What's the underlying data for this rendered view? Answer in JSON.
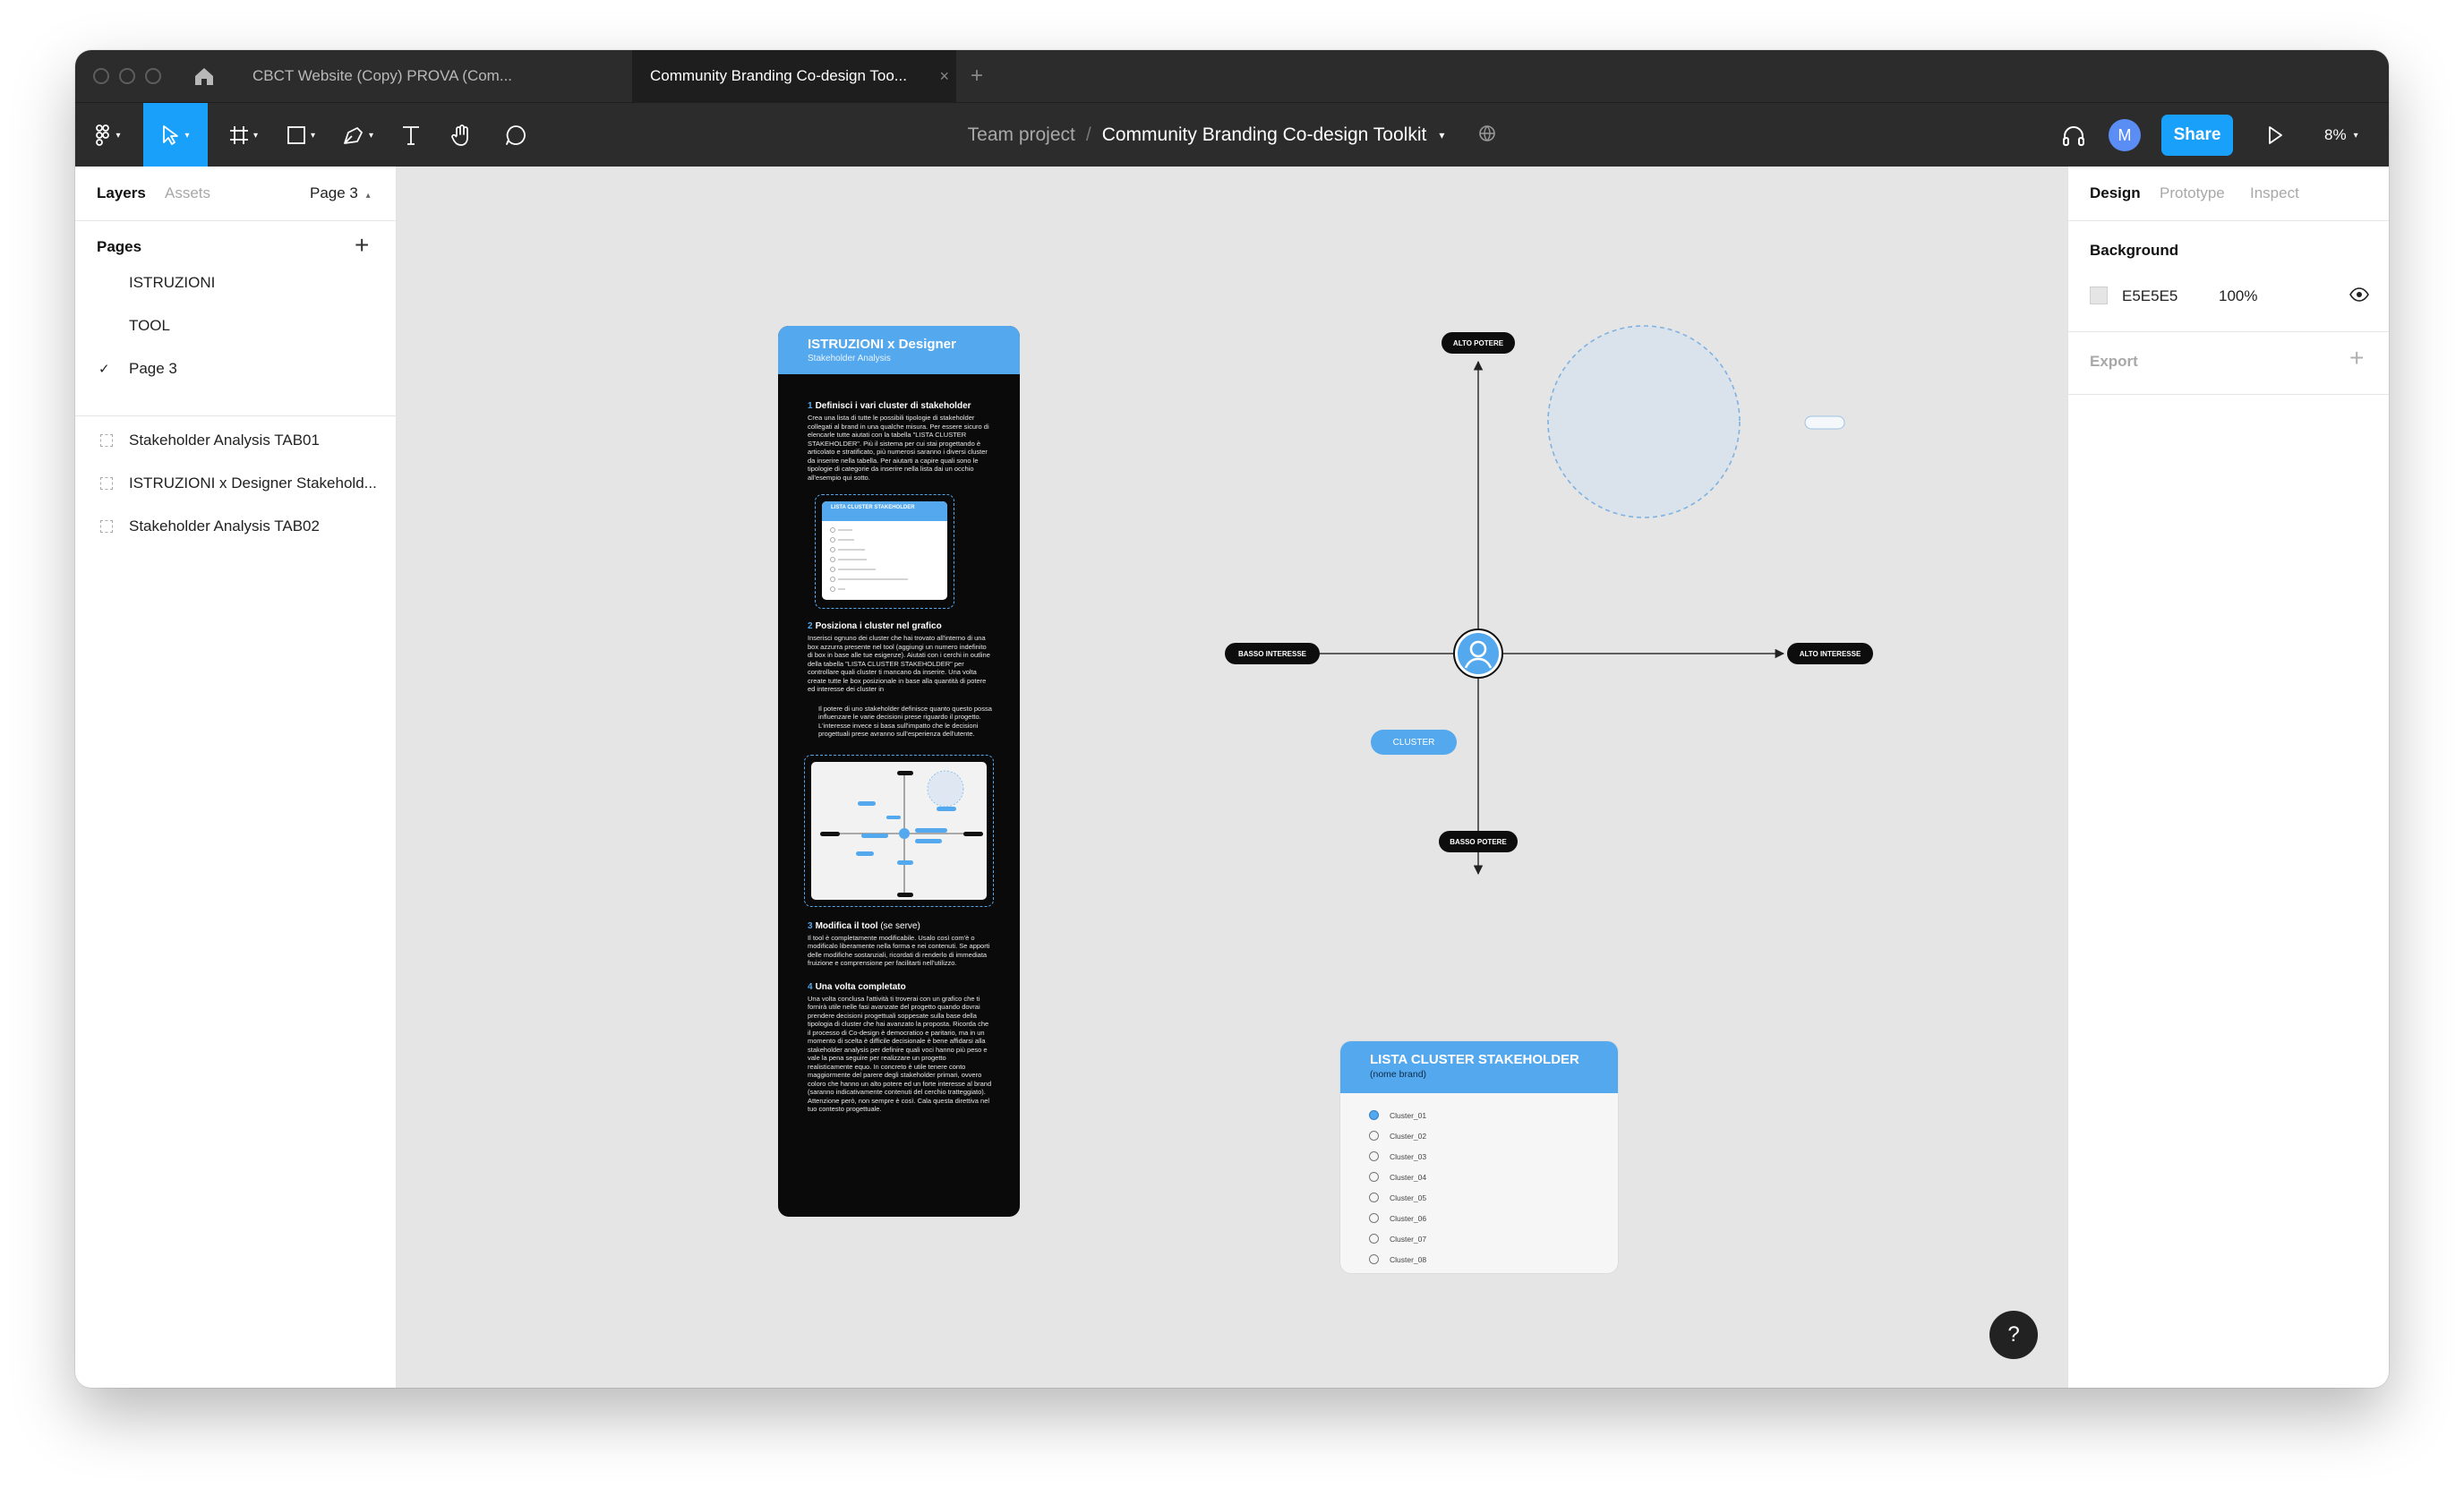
{
  "tabs": [
    {
      "label": "CBCT Website (Copy) PROVA (Com..."
    },
    {
      "label": "Community Branding Co-design Too..."
    }
  ],
  "toolbar": {
    "breadcrumb_parent": "Team project",
    "breadcrumb_sep": "/",
    "file_name": "Community Branding Co-design Toolkit",
    "avatar_initial": "M",
    "share_label": "Share",
    "zoom": "8%"
  },
  "left_panel": {
    "tab_layers": "Layers",
    "tab_assets": "Assets",
    "current_page": "Page 3",
    "pages_title": "Pages",
    "pages": [
      "ISTRUZIONI",
      "TOOL",
      "Page 3"
    ],
    "layers": [
      "Stakeholder Analysis TAB01",
      "ISTRUZIONI x Designer Stakehold...",
      "Stakeholder Analysis TAB02"
    ]
  },
  "right_panel": {
    "tab_design": "Design",
    "tab_prototype": "Prototype",
    "tab_inspect": "Inspect",
    "background_title": "Background",
    "bg_hex": "E5E5E5",
    "bg_opacity": "100%",
    "export_title": "Export",
    "help": "?"
  },
  "colors": {
    "accent": "#18a0fb",
    "card_blue": "#54a8ee",
    "canvas_bg": "#E5E5E5"
  },
  "instructions": {
    "title": "ISTRUZIONI x Designer",
    "subtitle": "Stakeholder Analysis",
    "step1_num": "1",
    "step1_title": "Definisci i vari cluster di stakeholder",
    "step1_body": "Crea una lista di tutte le possibili tipologie di stakeholder collegati al brand in una qualche misura. Per essere sicuro di elencarle tutte aiutati con la tabella \"LISTA CLUSTER STAKEHOLDER\". Più il sistema per cui stai progettando è articolato e stratificato, più numerosi saranno i diversi cluster da inserire nella tabella. Per aiutarti a capire quali sono le tipologie di categorie da inserire nella lista dai un occhio all'esempio qui sotto.",
    "mini_card_title": "LISTA CLUSTER STAKEHOLDER",
    "step2_num": "2",
    "step2_title": "Posiziona i cluster nel grafico",
    "step2_body": "Inserisci ognuno dei cluster che hai trovato all'interno di una box azzurra presente nel tool (aggiungi un numero indefinito di box in base alle tue esigenze). Aiutati con i cerchi in outline della tabella \"LISTA CLUSTER STAKEHOLDER\" per controllare quali cluster ti mancano da inserire. Una volta create tutte le box posizionale in base alla quantità di potere ed interesse dei cluster in",
    "step2_note": "Il potere di uno stakeholder definisce quanto questo possa influenzare le varie decisioni prese riguardo il progetto. L'interesse invece si basa sull'impatto che le decisioni progettuali prese avranno sull'esperienza dell'utente.",
    "step3_num": "3",
    "step3_title": "Modifica il tool",
    "step3_hint": "(se serve)",
    "step3_body": "Il tool è completamente modificabile. Usalo così com'è o modificalo liberamente nella forma e nei contenuti. Se apporti delle modifiche sostanziali, ricordati di renderlo di immediata fruizione e comprensione per facilitarti nell'utilizzo.",
    "step4_num": "4",
    "step4_title": "Una volta completato",
    "step4_body": "Una volta conclusa l'attività ti troverai con un grafico che ti fornirà utile nelle fasi avanzate del progetto quando dovrai prendere decisioni progettuali soppesate sulla base della tipologia di cluster che hai avanzato la proposta. Ricorda che il processo di Co-design è democratico e paritario, ma in un momento di scelta è difficile decisionale è bene affidarsi alla stakeholder analysis per definire quali voci hanno più peso e vale la pena seguire per realizzare un progetto realisticamente equo. In concreto è utile tenere conto maggiormente del parere degli stakeholder primari, ovvero coloro che hanno un alto potere ed un forte interesse al brand (saranno indicativamente contenuti del cerchio tratteggiato). Attenzione però, non sempre è così. Cala questa direttiva nel tuo contesto progettuale."
  },
  "matrix": {
    "alto_potere": "ALTO POTERE",
    "basso_potere": "BASSO POTERE",
    "basso_interesse": "BASSO INTERESSE",
    "alto_interesse": "ALTO INTERESSE",
    "cluster": "CLUSTER"
  },
  "cluster_list": {
    "title": "LISTA CLUSTER STAKEHOLDER",
    "subtitle": "(nome brand)",
    "items": [
      "Cluster_01",
      "Cluster_02",
      "Cluster_03",
      "Cluster_04",
      "Cluster_05",
      "Cluster_06",
      "Cluster_07",
      "Cluster_08"
    ],
    "checked_index": 0
  }
}
